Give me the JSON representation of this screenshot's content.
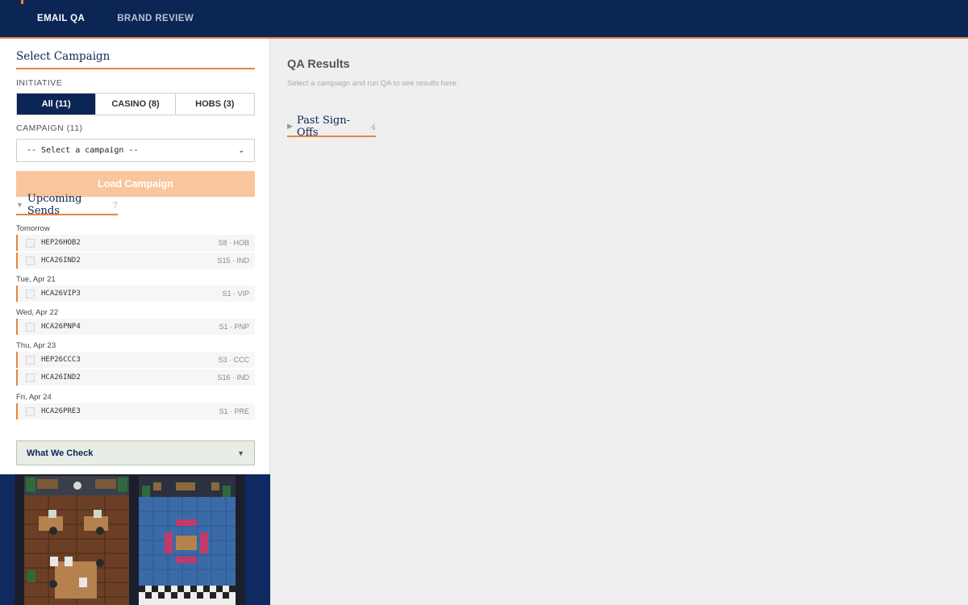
{
  "nav": {
    "tabs": [
      {
        "label": "EMAIL QA",
        "active": true
      },
      {
        "label": "BRAND REVIEW",
        "active": false
      }
    ],
    "accent": "#e9843d",
    "bg": "#0b2554"
  },
  "sidebar": {
    "title": "Select Campaign",
    "initiative_label": "INITIATIVE",
    "initiatives": [
      {
        "label": "All (11)",
        "active": true
      },
      {
        "label": "CASINO (8)",
        "active": false
      },
      {
        "label": "HOBS (3)",
        "active": false
      }
    ],
    "campaign_label": "CAMPAIGN (11)",
    "campaign_select": {
      "value": "-- Select a campaign --"
    },
    "load_button": "Load Campaign",
    "upcoming": {
      "title": "Upcoming Sends",
      "count": "7",
      "groups": [
        {
          "day": "Tomorrow",
          "items": [
            {
              "code": "HEP26HOB2",
              "meta": "S8 · HOB"
            },
            {
              "code": "HCA26IND2",
              "meta": "S15 · IND"
            }
          ]
        },
        {
          "day": "Tue, Apr 21",
          "items": [
            {
              "code": "HCA26VIP3",
              "meta": "S1 · VIP"
            }
          ]
        },
        {
          "day": "Wed, Apr 22",
          "items": [
            {
              "code": "HCA26PNP4",
              "meta": "S1 · PNP"
            }
          ]
        },
        {
          "day": "Thu, Apr 23",
          "items": [
            {
              "code": "HEP26CCC3",
              "meta": "S3 · CCC"
            },
            {
              "code": "HCA26IND2",
              "meta": "S16 · IND"
            }
          ]
        },
        {
          "day": "Fri, Apr 24",
          "items": [
            {
              "code": "HCA26PRE3",
              "meta": "S1 · PRE"
            }
          ]
        }
      ]
    },
    "what_we_check": "What We Check"
  },
  "main": {
    "title": "QA Results",
    "subtitle": "Select a campaign and run QA to see results here.",
    "past_signoffs": {
      "title": "Past Sign-Offs",
      "count": "4"
    }
  }
}
